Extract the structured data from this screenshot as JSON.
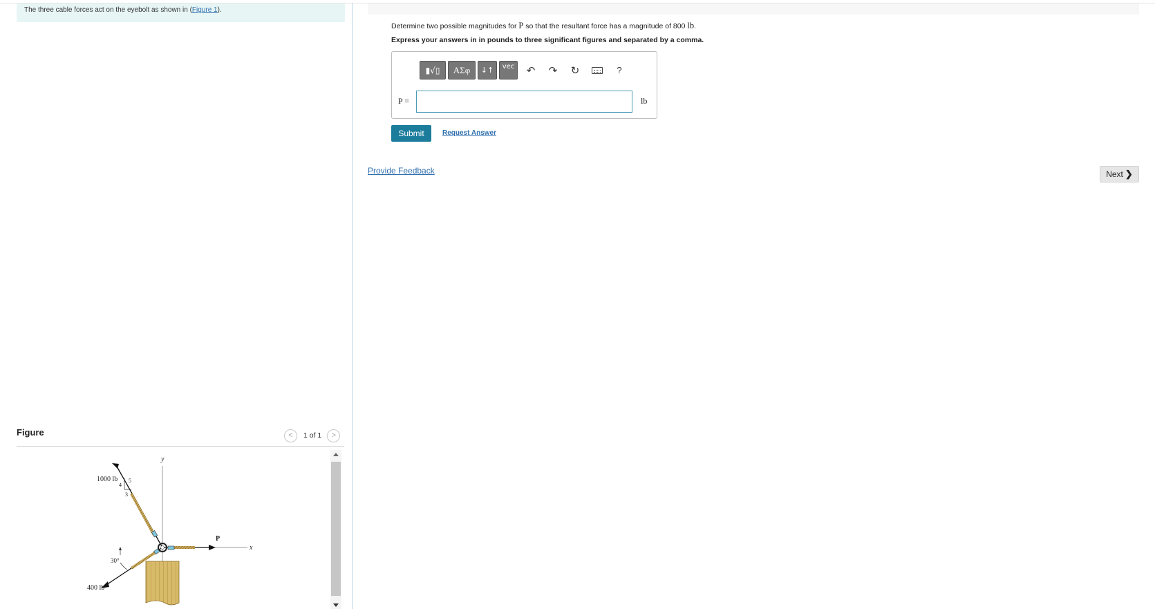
{
  "intro": {
    "text_before": "The three cable forces act on the eyebolt as shown in (",
    "figure_link": "Figure 1",
    "text_after": ")."
  },
  "question": {
    "text_before": "Determine two possible magnitudes for ",
    "symbol": "P",
    "text_middle": " so that the resultant force has a magnitude of 800 ",
    "unit_symbol": "lb",
    "text_after": ".",
    "instruction": "Express your answers in in pounds to three significant figures and separated by a comma."
  },
  "toolbar": {
    "templates_label": "▮√▯",
    "greek_label": "ΑΣφ",
    "arrows_label": "↓↑",
    "vec_label": "vec",
    "undo_label": "↶",
    "redo_label": "↷",
    "reset_label": "↻",
    "help_label": "?"
  },
  "answer": {
    "variable_label": "P =",
    "value": "",
    "placeholder": "",
    "unit": "lb"
  },
  "actions": {
    "submit_label": "Submit",
    "request_label": "Request Answer",
    "feedback_label": "Provide Feedback",
    "next_label": "Next",
    "next_chevron": "❯"
  },
  "figure": {
    "title": "Figure",
    "pager": "1 of 1",
    "prev_glyph": "<",
    "next_glyph": ">",
    "labels": {
      "y_axis": "y",
      "x_axis": "x",
      "force_top": "1000 lb",
      "force_bottom": "400 lb",
      "force_p": "P",
      "slope_4": "4",
      "slope_5": "5",
      "slope_3": "3",
      "angle": "30°"
    }
  },
  "colors": {
    "accent": "#1b7c9c",
    "link": "#2f6fae",
    "intro_bg": "#e7f5f5",
    "rope": "#c8a85a",
    "block": "#d8bb6a"
  }
}
